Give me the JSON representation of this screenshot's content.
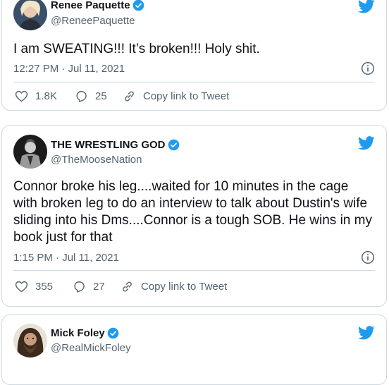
{
  "tweets": [
    {
      "name": "Renee Paquette",
      "handle": "@ReneePaquette",
      "text": "I am SWEATING!!! It’s broken!!! Holy shit.",
      "timestamp": "12:27 PM · Jul 11, 2021",
      "likes": "1.8K",
      "replies": "25",
      "copy_link": "Copy link to Tweet"
    },
    {
      "name": "THE WRESTLING GOD",
      "handle": "@TheMooseNation",
      "text": "Connor broke his leg....waited for 10 minutes in the cage with broken leg  to do an interview to talk about Dustin's wife sliding into his Dms....Connor is a tough SOB.  He wins in my book just for that",
      "timestamp": "1:15 PM · Jul 11, 2021",
      "likes": "355",
      "replies": "27",
      "copy_link": "Copy link to Tweet"
    },
    {
      "name": "Mick Foley",
      "handle": "@RealMickFoley"
    }
  ],
  "colors": {
    "brand_blue": "#1d9bf0",
    "text_primary": "#0f1419",
    "text_secondary": "#536471",
    "border": "#cfd9de"
  },
  "icons": [
    "verified-badge-icon",
    "twitter-bird-icon",
    "info-icon",
    "heart-icon",
    "reply-icon",
    "link-icon"
  ]
}
